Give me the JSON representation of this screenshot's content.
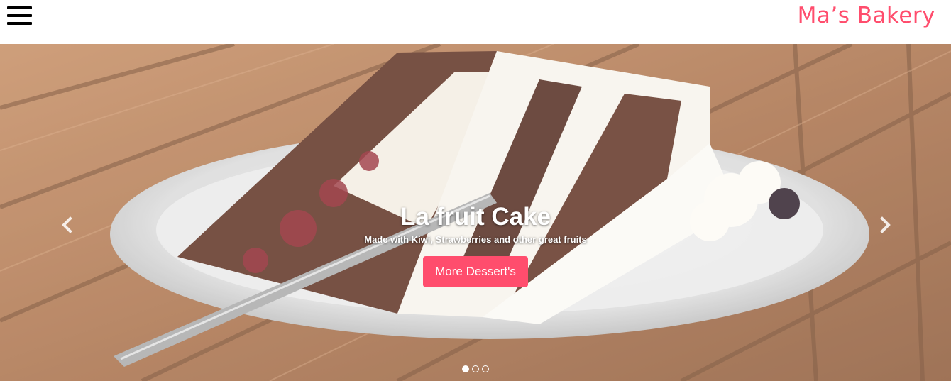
{
  "navbar": {
    "menu_icon": "hamburger-menu-icon",
    "brand": "Ma’s Bakery",
    "brand_color": "#ff4d6d"
  },
  "hero": {
    "image_subject": "slice of layered chocolate cake with cream on a white plate on a wooden table",
    "title": "La fruit Cake",
    "subtitle": "Made with Kiwi, Strawberries and other great fruits",
    "button_label": "More Dessert's",
    "button_color": "#ff4d6d",
    "prev_icon": "chevron-left-icon",
    "next_icon": "chevron-right-icon",
    "slides": [
      {
        "active": true
      },
      {
        "active": false
      },
      {
        "active": false
      }
    ]
  }
}
